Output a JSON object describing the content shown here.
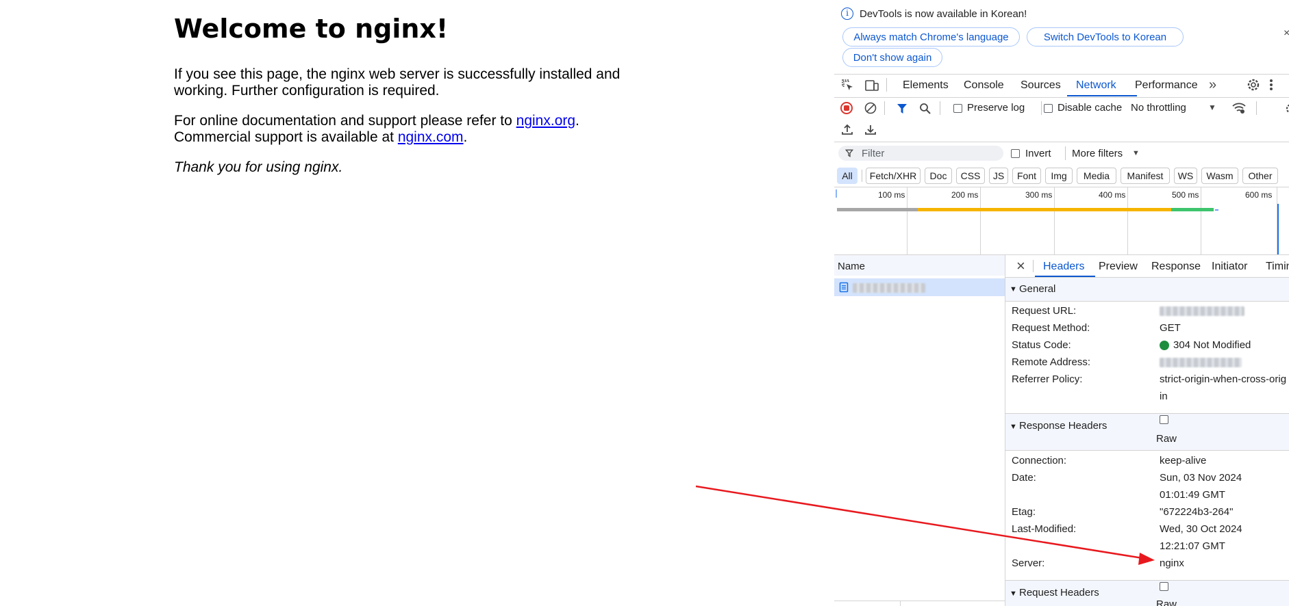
{
  "page": {
    "heading": "Welcome to nginx!",
    "p1_line1": "If you see this page, the nginx web server is successfully installed and",
    "p1_line2": "working. Further configuration is required.",
    "p2_pre": "For online documentation and support please refer to ",
    "link_org": "nginx.org",
    "p2_post": ".",
    "p2_line2_pre": "Commercial support is available at ",
    "link_com": "nginx.com",
    "p2_line2_post": ".",
    "thanks": "Thank you for using nginx."
  },
  "banner": {
    "message": "DevTools is now available in Korean!",
    "btn_match": "Always match Chrome's language",
    "btn_switch": "Switch DevTools to Korean",
    "btn_dont": "Don't show again"
  },
  "tabs": [
    "Elements",
    "Console",
    "Sources",
    "Network",
    "Performance"
  ],
  "active_tab": "Network",
  "toolbar": {
    "preserve_log": "Preserve log",
    "disable_cache": "Disable cache",
    "throttling": "No throttling"
  },
  "filter": {
    "placeholder": "Filter",
    "invert": "Invert",
    "more_filters": "More filters"
  },
  "type_filters": [
    "All",
    "Fetch/XHR",
    "Doc",
    "CSS",
    "JS",
    "Font",
    "Img",
    "Media",
    "Manifest",
    "WS",
    "Wasm",
    "Other"
  ],
  "timeline_ticks": [
    "100 ms",
    "200 ms",
    "300 ms",
    "400 ms",
    "500 ms",
    "600 ms"
  ],
  "requests": {
    "name_header": "Name"
  },
  "detail_tabs": [
    "Headers",
    "Preview",
    "Response",
    "Initiator",
    "Timin"
  ],
  "general": {
    "title": "General",
    "rows": [
      {
        "key": "Request URL:",
        "value": ""
      },
      {
        "key": "Request Method:",
        "value": "GET"
      },
      {
        "key": "Status Code:",
        "value": "304 Not Modified"
      },
      {
        "key": "Remote Address:",
        "value": ""
      },
      {
        "key": "Referrer Policy:",
        "value": "strict-origin-when-cross-orig"
      }
    ],
    "referrer_cont": "in"
  },
  "response_headers": {
    "title": "Response Headers",
    "raw": "Raw",
    "rows": [
      {
        "key": "Connection:",
        "value": "keep-alive"
      },
      {
        "key": "Date:",
        "value": "Sun, 03 Nov 2024"
      },
      {
        "key": "",
        "value": "01:01:49 GMT"
      },
      {
        "key": "Etag:",
        "value": "\"672224b3-264\""
      },
      {
        "key": "Last-Modified:",
        "value": "Wed, 30 Oct 2024"
      },
      {
        "key": "",
        "value": "12:21:07 GMT"
      },
      {
        "key": "Server:",
        "value": "nginx"
      }
    ]
  },
  "request_headers": {
    "title": "Request Headers",
    "raw": "Raw"
  },
  "colors": {
    "accent": "#0b57d0",
    "status_ok": "#1e8e3e",
    "arrow": "#e8191e",
    "bar_gray": "#a6a6a6",
    "bar_orange": "#f5b400",
    "bar_green": "#3ec46d"
  }
}
